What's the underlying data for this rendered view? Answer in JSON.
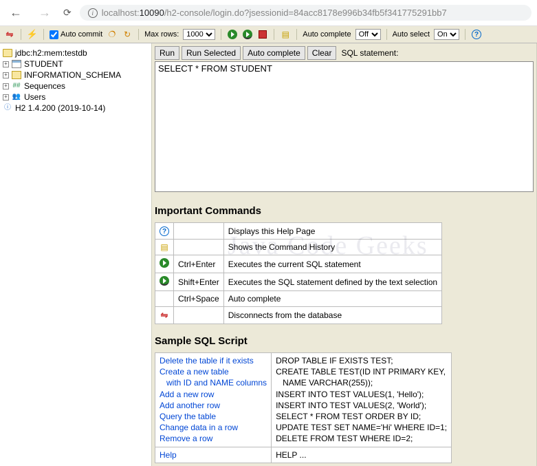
{
  "browser": {
    "url_host": "localhost:",
    "url_port": "10090",
    "url_path": "/h2-console/login.do?jsessionid=84acc8178e996b34fb5f341775291bb7"
  },
  "toolbar": {
    "auto_commit": "Auto commit",
    "max_rows": "Max rows:",
    "max_rows_value": "1000",
    "auto_complete": "Auto complete",
    "auto_complete_value": "Off",
    "auto_select": "Auto select",
    "auto_select_value": "On"
  },
  "sidebar": {
    "db": "jdbc:h2:mem:testdb",
    "items": [
      {
        "label": "STUDENT",
        "icon": "tbl"
      },
      {
        "label": "INFORMATION_SCHEMA",
        "icon": "folder"
      },
      {
        "label": "Sequences",
        "icon": "hash"
      },
      {
        "label": "Users",
        "icon": "users"
      }
    ],
    "version": "H2 1.4.200 (2019-10-14)"
  },
  "sql": {
    "run": "Run",
    "run_selected": "Run Selected",
    "auto_complete": "Auto complete",
    "clear": "Clear",
    "statement_label": "SQL statement:",
    "statement_value": "SELECT * FROM STUDENT"
  },
  "commands": {
    "title": "Important Commands",
    "rows": [
      {
        "icon": "help",
        "key": "",
        "desc": "Displays this Help Page"
      },
      {
        "icon": "history",
        "key": "",
        "desc": "Shows the Command History"
      },
      {
        "icon": "play",
        "key": "Ctrl+Enter",
        "desc": "Executes the current SQL statement"
      },
      {
        "icon": "play-sel",
        "key": "Shift+Enter",
        "desc": "Executes the SQL statement defined by the text selection"
      },
      {
        "icon": "",
        "key": "Ctrl+Space",
        "desc": "Auto complete"
      },
      {
        "icon": "disconnect",
        "key": "",
        "desc": "Disconnects from the database"
      }
    ]
  },
  "script": {
    "title": "Sample SQL Script",
    "rows": [
      {
        "link": "Delete the table if it exists",
        "sql": "DROP TABLE IF EXISTS TEST;"
      },
      {
        "link": "Create a new table",
        "sql": "CREATE TABLE TEST(ID INT PRIMARY KEY,"
      },
      {
        "link": "with ID and NAME columns",
        "indent": true,
        "sql": "   NAME VARCHAR(255));"
      },
      {
        "link": "Add a new row",
        "sql": "INSERT INTO TEST VALUES(1, 'Hello');"
      },
      {
        "link": "Add another row",
        "sql": "INSERT INTO TEST VALUES(2, 'World');"
      },
      {
        "link": "Query the table",
        "sql": "SELECT * FROM TEST ORDER BY ID;"
      },
      {
        "link": "Change data in a row",
        "sql": "UPDATE TEST SET NAME='Hi' WHERE ID=1;"
      },
      {
        "link": "Remove a row",
        "sql": "DELETE FROM TEST WHERE ID=2;"
      }
    ],
    "help_link": "Help",
    "help_sql": "HELP ..."
  }
}
